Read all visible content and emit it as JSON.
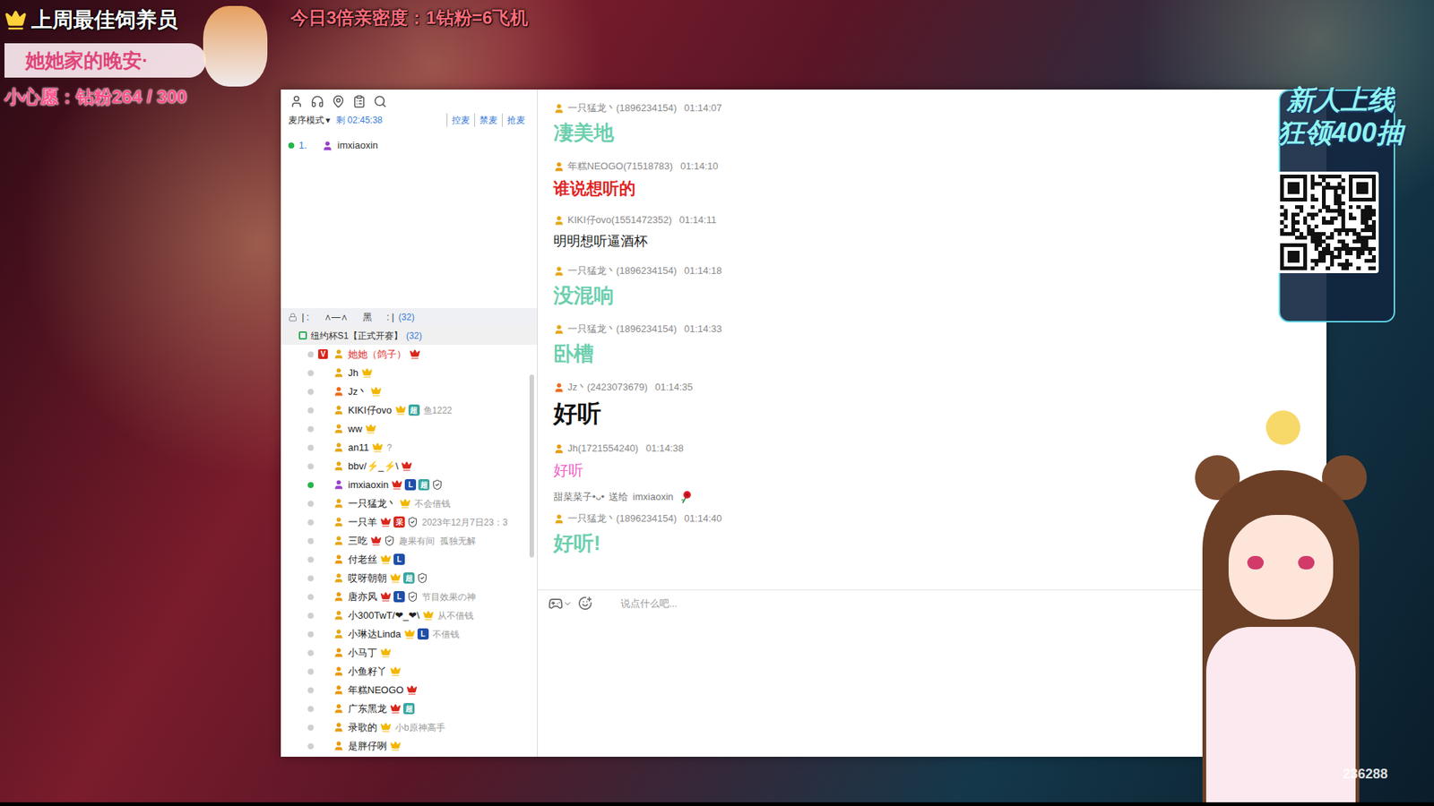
{
  "stream_overlay": {
    "best_keeper_title": "上周最佳饲养员",
    "best_keeper_name": "她她家的晚安·",
    "wish": "小心愿：钻粉264 / 300",
    "intimacy_banner": "今日3倍亲密度：1钻粉=6飞机",
    "promo_lines": [
      "新人上线",
      "狂领400抽"
    ],
    "watermark": "236288"
  },
  "mic_queue": {
    "mode": "麦序模式",
    "mode_arrow": "▾",
    "remaining": "剩 02:45:38",
    "actions": [
      "控麦",
      "禁麦",
      "抢麦"
    ],
    "entries": [
      {
        "index": "1.",
        "name": "imxiaoxin",
        "speaking": true,
        "role_color": "#9b3fc9"
      }
    ]
  },
  "channel": {
    "name": "| :      ∧—∧      黑      : |",
    "count": "(32)",
    "subchannel": {
      "name": "纽约杯S1【正式开赛】",
      "count": "(32)",
      "selected": true
    }
  },
  "members": [
    {
      "name": "她她（鸽子）",
      "name_color": "#e03030",
      "role_color": "#e3a816",
      "speaking": false,
      "lead_badge": {
        "text": "V",
        "color": "#d9261c"
      },
      "badges": [
        {
          "kind": "crown",
          "color": "#d9261c"
        }
      ],
      "note": ""
    },
    {
      "name": "Jh",
      "name_color": "#222222",
      "role_color": "#e3a816",
      "speaking": false,
      "badges": [
        {
          "kind": "crown",
          "color": "#f2b600"
        }
      ],
      "note": ""
    },
    {
      "name": "Jz丶",
      "name_color": "#222222",
      "role_color": "#f06a1a",
      "speaking": false,
      "badges": [
        {
          "kind": "crown",
          "color": "#f2b600"
        }
      ],
      "note": ""
    },
    {
      "name": "KIKI仔ovo",
      "name_color": "#222222",
      "role_color": "#e3a816",
      "speaking": false,
      "badges": [
        {
          "kind": "crown",
          "color": "#f2b600"
        },
        {
          "kind": "tag",
          "text": "超",
          "color": "#3aa6a0"
        }
      ],
      "note": "鱼1222"
    },
    {
      "name": "ww",
      "name_color": "#222222",
      "role_color": "#e3a816",
      "speaking": false,
      "badges": [
        {
          "kind": "crown",
          "color": "#f2b600"
        }
      ],
      "note": ""
    },
    {
      "name": "an11",
      "name_color": "#222222",
      "role_color": "#e3a816",
      "speaking": false,
      "badges": [
        {
          "kind": "crown",
          "color": "#f2b600"
        }
      ],
      "note": "?"
    },
    {
      "name": "bbv/⚡_⚡\\",
      "name_color": "#222222",
      "role_color": "#e3a816",
      "speaking": false,
      "badges": [
        {
          "kind": "crown",
          "color": "#d9261c"
        }
      ],
      "note": ""
    },
    {
      "name": "imxiaoxin",
      "name_color": "#222222",
      "role_color": "#9b3fc9",
      "speaking": true,
      "badges": [
        {
          "kind": "crown",
          "color": "#d9261c"
        },
        {
          "kind": "tag",
          "text": "L",
          "color": "#1f4fa8"
        },
        {
          "kind": "tag",
          "text": "超",
          "color": "#3aa6a0"
        },
        {
          "kind": "shield",
          "color": "#555555"
        }
      ],
      "note": ""
    },
    {
      "name": "一只猛龙丶",
      "name_color": "#222222",
      "role_color": "#e3a816",
      "speaking": false,
      "badges": [
        {
          "kind": "crown",
          "color": "#f2b600"
        }
      ],
      "note": "不会借钱"
    },
    {
      "name": "一只羊",
      "name_color": "#222222",
      "role_color": "#e3a816",
      "speaking": false,
      "badges": [
        {
          "kind": "crown",
          "color": "#d9261c"
        },
        {
          "kind": "tag",
          "text": "采",
          "color": "#d9261c"
        },
        {
          "kind": "shield",
          "color": "#555555"
        }
      ],
      "note": "2023年12月7日23：3"
    },
    {
      "name": "三吃",
      "name_color": "#222222",
      "role_color": "#e3a816",
      "speaking": false,
      "badges": [
        {
          "kind": "crown",
          "color": "#d9261c"
        },
        {
          "kind": "shield",
          "color": "#555555"
        }
      ],
      "note": "趣果有间  孤独无解"
    },
    {
      "name": "付老丝",
      "name_color": "#222222",
      "role_color": "#e89a10",
      "speaking": false,
      "badges": [
        {
          "kind": "crown",
          "color": "#f2b600"
        },
        {
          "kind": "tag",
          "text": "L",
          "color": "#1f4fa8"
        }
      ],
      "note": ""
    },
    {
      "name": "哎呀朝朝",
      "name_color": "#222222",
      "role_color": "#e3a816",
      "speaking": false,
      "badges": [
        {
          "kind": "crown",
          "color": "#f2b600"
        },
        {
          "kind": "tag",
          "text": "超",
          "color": "#3aa6a0"
        },
        {
          "kind": "shield",
          "color": "#555555"
        }
      ],
      "note": ""
    },
    {
      "name": "唐亦风",
      "name_color": "#222222",
      "role_color": "#e89a10",
      "speaking": false,
      "badges": [
        {
          "kind": "crown",
          "color": "#d9261c"
        },
        {
          "kind": "tag",
          "text": "L",
          "color": "#1f4fa8"
        },
        {
          "kind": "shield",
          "color": "#555555"
        }
      ],
      "note": "节目效果の神"
    },
    {
      "name": "小300TwT/❤_❤\\",
      "name_color": "#222222",
      "role_color": "#e3a816",
      "speaking": false,
      "badges": [
        {
          "kind": "crown",
          "color": "#f2b600"
        }
      ],
      "note": "从不借钱"
    },
    {
      "name": "小琳达Linda",
      "name_color": "#222222",
      "role_color": "#e3a816",
      "speaking": false,
      "badges": [
        {
          "kind": "crown",
          "color": "#f2b600"
        },
        {
          "kind": "tag",
          "text": "L",
          "color": "#1f4fa8"
        }
      ],
      "note": "不借钱"
    },
    {
      "name": "小马丁",
      "name_color": "#222222",
      "role_color": "#e89a10",
      "speaking": false,
      "badges": [
        {
          "kind": "crown",
          "color": "#f2b600"
        }
      ],
      "note": ""
    },
    {
      "name": "小鱼籽丫",
      "name_color": "#222222",
      "role_color": "#e89a10",
      "speaking": false,
      "badges": [
        {
          "kind": "crown",
          "color": "#f2b600"
        }
      ],
      "note": ""
    },
    {
      "name": "年糕NEOGO",
      "name_color": "#222222",
      "role_color": "#e89a10",
      "speaking": false,
      "badges": [
        {
          "kind": "crown",
          "color": "#d9261c"
        }
      ],
      "note": ""
    },
    {
      "name": "广东黑龙",
      "name_color": "#222222",
      "role_color": "#e89a10",
      "speaking": false,
      "badges": [
        {
          "kind": "crown",
          "color": "#d9261c"
        },
        {
          "kind": "tag",
          "text": "超",
          "color": "#3aa6a0"
        }
      ],
      "note": ""
    },
    {
      "name": "录歌的",
      "name_color": "#222222",
      "role_color": "#e89a10",
      "speaking": false,
      "badges": [
        {
          "kind": "crown",
          "color": "#f2b600"
        }
      ],
      "note": "小b原神高手"
    },
    {
      "name": "是胖仔咧",
      "name_color": "#222222",
      "role_color": "#e89a10",
      "speaking": false,
      "badges": [
        {
          "kind": "crown",
          "color": "#f2b600"
        }
      ],
      "note": ""
    }
  ],
  "chat": {
    "messages": [
      {
        "kind": "large",
        "user": "一只猛龙丶",
        "uid": "(1896234154)",
        "time": "01:14:07",
        "role_color": "#e3a816",
        "text": "凄美地",
        "color": "#6ccfae"
      },
      {
        "kind": "medium",
        "user": "年糕NEOGO",
        "uid": "(71518783)",
        "time": "01:14:10",
        "role_color": "#e89a10",
        "text": "谁说想听的",
        "color": "#e02424"
      },
      {
        "kind": "normal",
        "user": "KIKI仔ovo",
        "uid": "(1551472352)",
        "time": "01:14:11",
        "role_color": "#e3a816",
        "text": "明明想听逼酒杯",
        "color": "#1a1a1a"
      },
      {
        "kind": "large",
        "user": "一只猛龙丶",
        "uid": "(1896234154)",
        "time": "01:14:18",
        "role_color": "#e3a816",
        "text": "没混响",
        "color": "#6ccfae"
      },
      {
        "kind": "large",
        "user": "一只猛龙丶",
        "uid": "(1896234154)",
        "time": "01:14:33",
        "role_color": "#e3a816",
        "text": "卧槽",
        "color": "#6ccfae"
      },
      {
        "kind": "xlarge",
        "user": "Jz丶",
        "uid": "(2423073679)",
        "time": "01:14:35",
        "role_color": "#f06a1a",
        "text": "好听",
        "color": "#111111"
      },
      {
        "kind": "small",
        "user": "Jh",
        "uid": "(1721554240)",
        "time": "01:14:38",
        "role_color": "#e89a10",
        "text": "好听",
        "color": "#f25fc3"
      },
      {
        "kind": "gift",
        "sender": "甜菜菜子•ᴗ•",
        "verb": "送给",
        "receiver": "imxiaoxin"
      },
      {
        "kind": "large",
        "user": "一只猛龙丶",
        "uid": "(1896234154)",
        "time": "01:14:40",
        "role_color": "#e3a816",
        "text": "好听!",
        "color": "#6ccfae"
      }
    ],
    "input_placeholder": "说点什么吧..."
  }
}
